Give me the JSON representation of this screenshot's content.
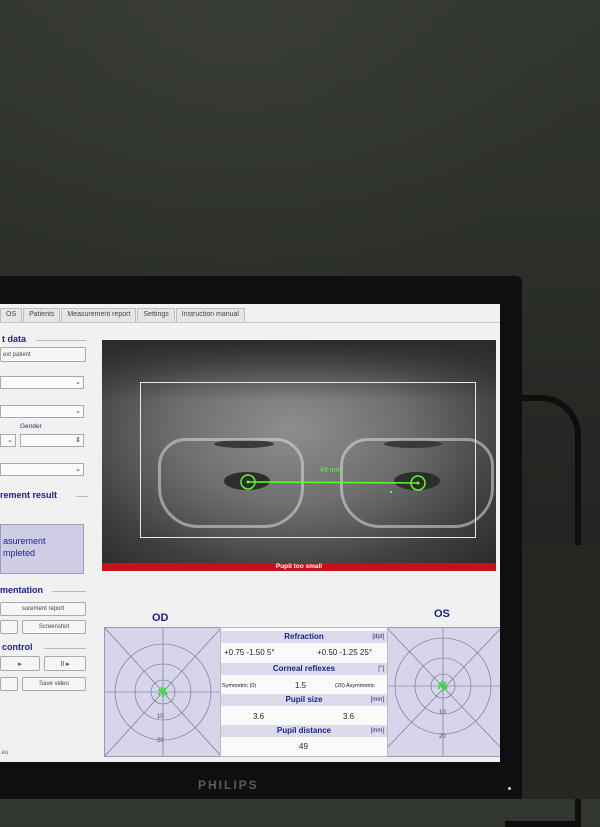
{
  "tabs": [
    "OS",
    "Patients",
    "Measurement report",
    "Settings",
    "Instruction manual"
  ],
  "left": {
    "patient_title": "t data",
    "next_patient_btn": "ext patient",
    "gender_label": "Gender",
    "result_title": "rement result",
    "result_line1": "asurement",
    "result_line2": "mpleted",
    "docu_title": "mentation",
    "report_btn": "surement report",
    "screenshot_btn": "Screenshot",
    "control_title": "control",
    "play_btn": "▸",
    "pause_btn": "II ▸",
    "save_video_btn": "Save video",
    "footer": ".eu"
  },
  "camera": {
    "distance_label": "49 mm",
    "warning": "Pupil too small"
  },
  "od_label": "OD",
  "os_label": "OS",
  "polar_ticks": [
    "10",
    "20"
  ],
  "measurements": {
    "refraction_title": "Refraction",
    "refraction_unit": "[dpt]",
    "od_refraction": "+0.75  -1.50 5°",
    "os_refraction": "+0.50  -1.25 25°",
    "corneal_title": "Corneal reflexes",
    "corneal_unit": "[°]",
    "corneal_left": "Symmetric (0)",
    "corneal_value": "1.5",
    "corneal_right": "(20) Asymmetric",
    "pupil_size_title": "Pupil size",
    "pupil_size_unit": "[mm]",
    "pupil_od": "3.6",
    "pupil_os": "3.6",
    "pupil_dist_title": "Pupil distance",
    "pupil_dist_unit": "[mm]",
    "pupil_dist_value": "49"
  },
  "brand": "PHILIPS",
  "colors": {
    "accent": "#1b1f86",
    "warning": "#c8101a",
    "marker": "#5aff2a"
  }
}
